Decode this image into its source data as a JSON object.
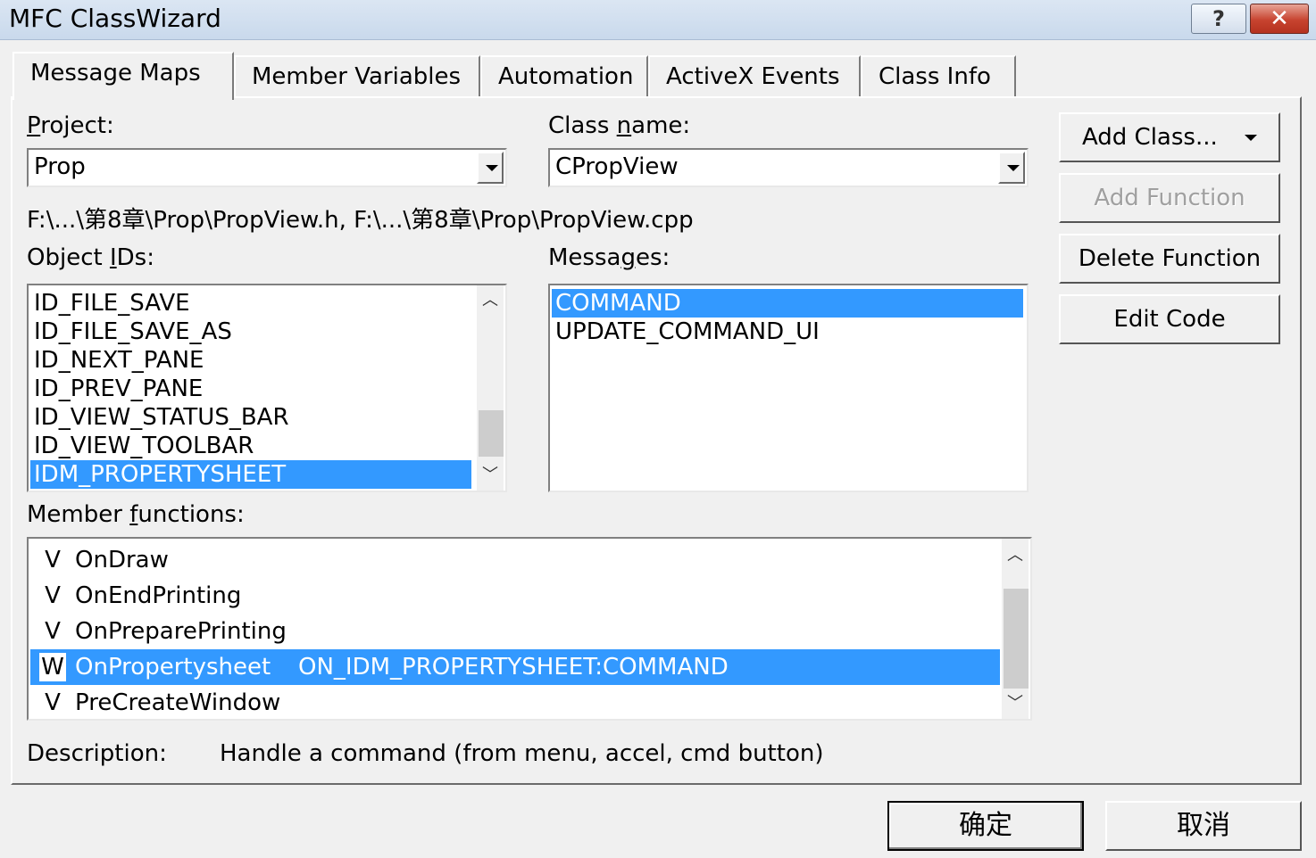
{
  "window": {
    "title": "MFC ClassWizard",
    "help_glyph": "?",
    "close_glyph": "✕"
  },
  "tabs": [
    {
      "label": "Message Maps",
      "active": true
    },
    {
      "label": "Member Variables",
      "active": false
    },
    {
      "label": "Automation",
      "active": false
    },
    {
      "label": "ActiveX Events",
      "active": false
    },
    {
      "label": "Class Info",
      "active": false
    }
  ],
  "project": {
    "label": "Project:",
    "mnemonic": "P",
    "value": "Prop"
  },
  "class_name": {
    "label_pre": "Class ",
    "label_mnemonic": "n",
    "label_post": "ame:",
    "value": "CPropView"
  },
  "file_path": "F:\\...\\第8章\\Prop\\PropView.h, F:\\...\\第8章\\Prop\\PropView.cpp",
  "object_ids": {
    "label_pre": "Object ",
    "label_mnemonic": "I",
    "label_post": "Ds:",
    "items": [
      "ID_FILE_SAVE",
      "ID_FILE_SAVE_AS",
      "ID_NEXT_PANE",
      "ID_PREV_PANE",
      "ID_VIEW_STATUS_BAR",
      "ID_VIEW_TOOLBAR",
      "IDM_PROPERTYSHEET"
    ],
    "selected_index": 6
  },
  "messages": {
    "label_pre": "Messa",
    "label_mnemonic": "g",
    "label_post": "es:",
    "items": [
      "COMMAND",
      "UPDATE_COMMAND_UI"
    ],
    "selected_index": 0
  },
  "member_functions": {
    "label_pre": "Member ",
    "label_mnemonic": "f",
    "label_post": "unctions:",
    "items": [
      {
        "flag": "V",
        "name": "OnDraw",
        "handler": ""
      },
      {
        "flag": "V",
        "name": "OnEndPrinting",
        "handler": ""
      },
      {
        "flag": "V",
        "name": "OnPreparePrinting",
        "handler": ""
      },
      {
        "flag": "W",
        "name": "OnPropertysheet",
        "handler": "ON_IDM_PROPERTYSHEET:COMMAND"
      },
      {
        "flag": "V",
        "name": "PreCreateWindow",
        "handler": ""
      }
    ],
    "selected_index": 3
  },
  "description": {
    "label": "Description:",
    "text": "Handle a command (from menu, accel, cmd button)"
  },
  "buttons": {
    "add_class": "Add Class...",
    "add_function": "Add Function",
    "delete_function": "Delete Function",
    "edit_code": "Edit Code",
    "ok": "确定",
    "cancel": "取消"
  },
  "colors": {
    "selection": "#3399ff",
    "dialog_bg": "#f0f0f0",
    "close_button": "#c7432f"
  },
  "icons": {
    "help": "help-icon",
    "close": "close-icon",
    "dropdown": "chevron-down-icon",
    "scroll_up": "scroll-up-arrow-icon",
    "scroll_down": "scroll-down-arrow-icon"
  }
}
